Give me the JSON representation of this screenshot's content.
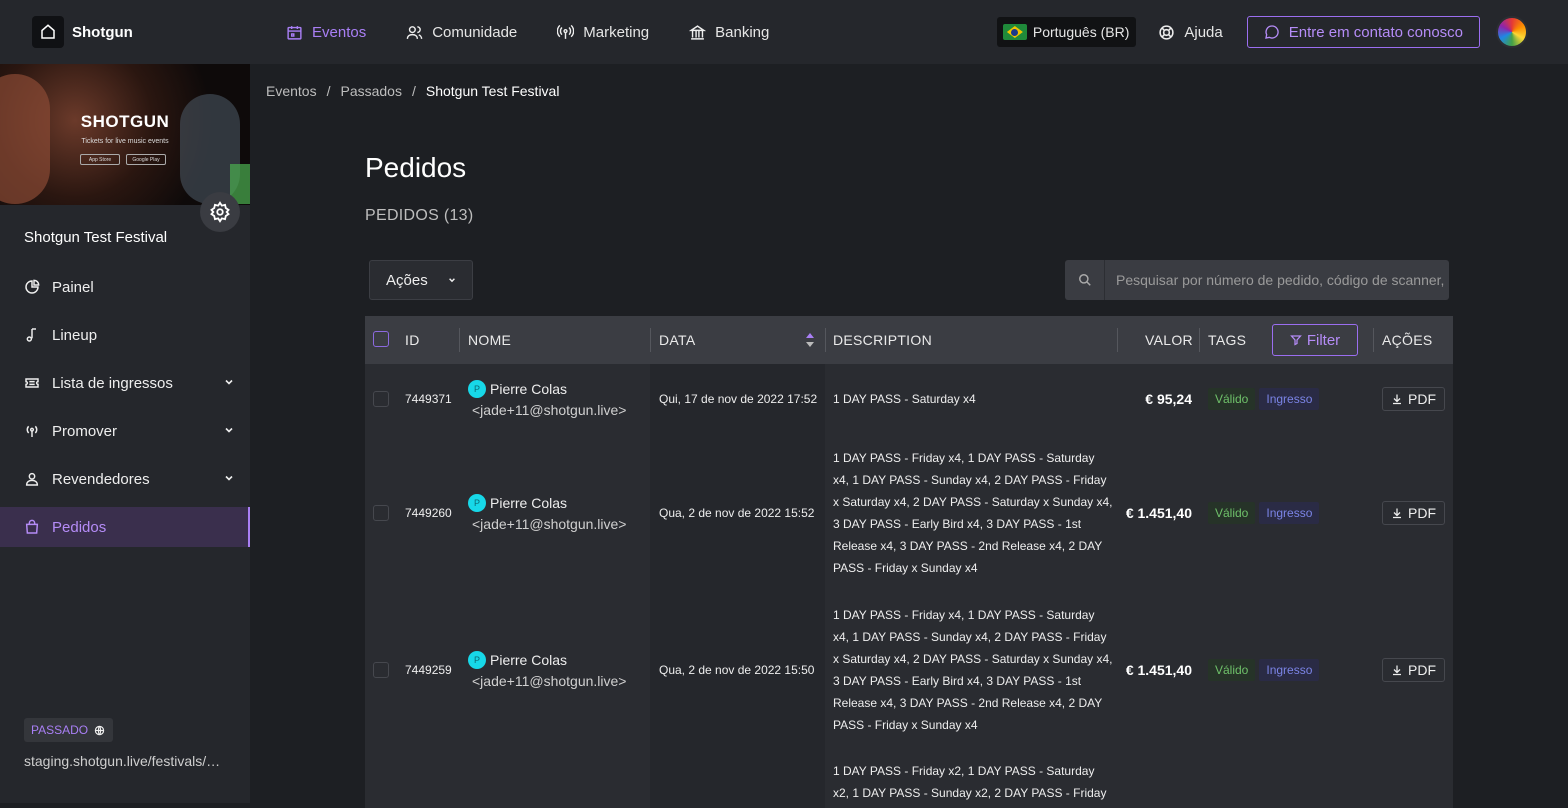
{
  "header": {
    "brand": "Shotgun",
    "nav": [
      {
        "label": "Eventos",
        "icon": "calendar-icon",
        "active": true
      },
      {
        "label": "Comunidade",
        "icon": "users-icon",
        "active": false
      },
      {
        "label": "Marketing",
        "icon": "broadcast-icon",
        "active": false
      },
      {
        "label": "Banking",
        "icon": "bank-icon",
        "active": false
      }
    ],
    "language": "Português (BR)",
    "help": "Ajuda",
    "contact": "Entre em contato conosco"
  },
  "sidebar": {
    "cover": {
      "logo": "SHOTGUN",
      "tagline": "Tickets for live music events",
      "store1": "App Store",
      "store2": "Google Play"
    },
    "festival_name": "Shotgun Test Festival",
    "items": [
      {
        "label": "Painel",
        "icon": "pie-chart-icon",
        "expandable": false
      },
      {
        "label": "Lineup",
        "icon": "music-note-icon",
        "expandable": false
      },
      {
        "label": "Lista de ingressos",
        "icon": "ticket-icon",
        "expandable": true
      },
      {
        "label": "Promover",
        "icon": "broadcast-icon",
        "expandable": true
      },
      {
        "label": "Revendedores",
        "icon": "user-icon",
        "expandable": true
      },
      {
        "label": "Pedidos",
        "icon": "shopping-bag-icon",
        "expandable": false,
        "active": true
      }
    ],
    "status": "PASSADO",
    "url": "staging.shotgun.live/festivals/shotgun-test-festival"
  },
  "breadcrumb": [
    "Eventos",
    "Passados",
    "Shotgun Test Festival"
  ],
  "page": {
    "title": "Pedidos",
    "count_label": "PEDIDOS (13)",
    "actions_label": "Ações",
    "search_placeholder": "Pesquisar por número de pedido, código de scanner, nome ou e-mail"
  },
  "table": {
    "columns": {
      "id": "ID",
      "name": "NOME",
      "date": "DATA",
      "description": "DESCRIPTION",
      "value": "VALOR",
      "tags": "TAGS",
      "filter": "Filter",
      "actions": "AÇÕES"
    },
    "rows": [
      {
        "id": "7449371",
        "initial": "P",
        "name": "Pierre Colas",
        "email": "<jade+11@shotgun.live>",
        "date": "Qui, 17 de nov de 2022 17:52",
        "description": "1 DAY PASS - Saturday x4",
        "value": "€ 95,24",
        "tag1": "Válido",
        "tag2": "Ingresso",
        "action": "PDF"
      },
      {
        "id": "7449260",
        "initial": "P",
        "name": "Pierre Colas",
        "email": "<jade+11@shotgun.live>",
        "date": "Qua, 2 de nov de 2022 15:52",
        "description": "1 DAY PASS - Friday x4, 1 DAY PASS - Saturday x4, 1 DAY PASS - Sunday x4, 2 DAY PASS - Friday x Saturday x4, 2 DAY PASS - Saturday x Sunday x4, 3 DAY PASS - Early Bird x4, 3 DAY PASS - 1st Release x4, 3 DAY PASS - 2nd Release x4, 2 DAY PASS - Friday x Sunday x4",
        "value": "€ 1.451,40",
        "tag1": "Válido",
        "tag2": "Ingresso",
        "action": "PDF"
      },
      {
        "id": "7449259",
        "initial": "P",
        "name": "Pierre Colas",
        "email": "<jade+11@shotgun.live>",
        "date": "Qua, 2 de nov de 2022 15:50",
        "description": "1 DAY PASS - Friday x4, 1 DAY PASS - Saturday x4, 1 DAY PASS - Sunday x4, 2 DAY PASS - Friday x Saturday x4, 2 DAY PASS - Saturday x Sunday x4, 3 DAY PASS - Early Bird x4, 3 DAY PASS - 1st Release x4, 3 DAY PASS - 2nd Release x4, 2 DAY PASS - Friday x Sunday x4",
        "value": "€ 1.451,40",
        "tag1": "Válido",
        "tag2": "Ingresso",
        "action": "PDF"
      },
      {
        "id": "",
        "initial": "",
        "name": "",
        "email": "",
        "date": "",
        "description": "1 DAY PASS - Friday x2, 1 DAY PASS - Saturday x2, 1 DAY PASS - Sunday x2, 2 DAY PASS - Friday",
        "value": "",
        "tag1": "",
        "tag2": "",
        "action": ""
      }
    ]
  },
  "colors": {
    "accent": "#a97ff5",
    "background": "#1d1f23",
    "panel": "#25272c",
    "valid": "#6fc16a",
    "ticket": "#7b84e6"
  }
}
